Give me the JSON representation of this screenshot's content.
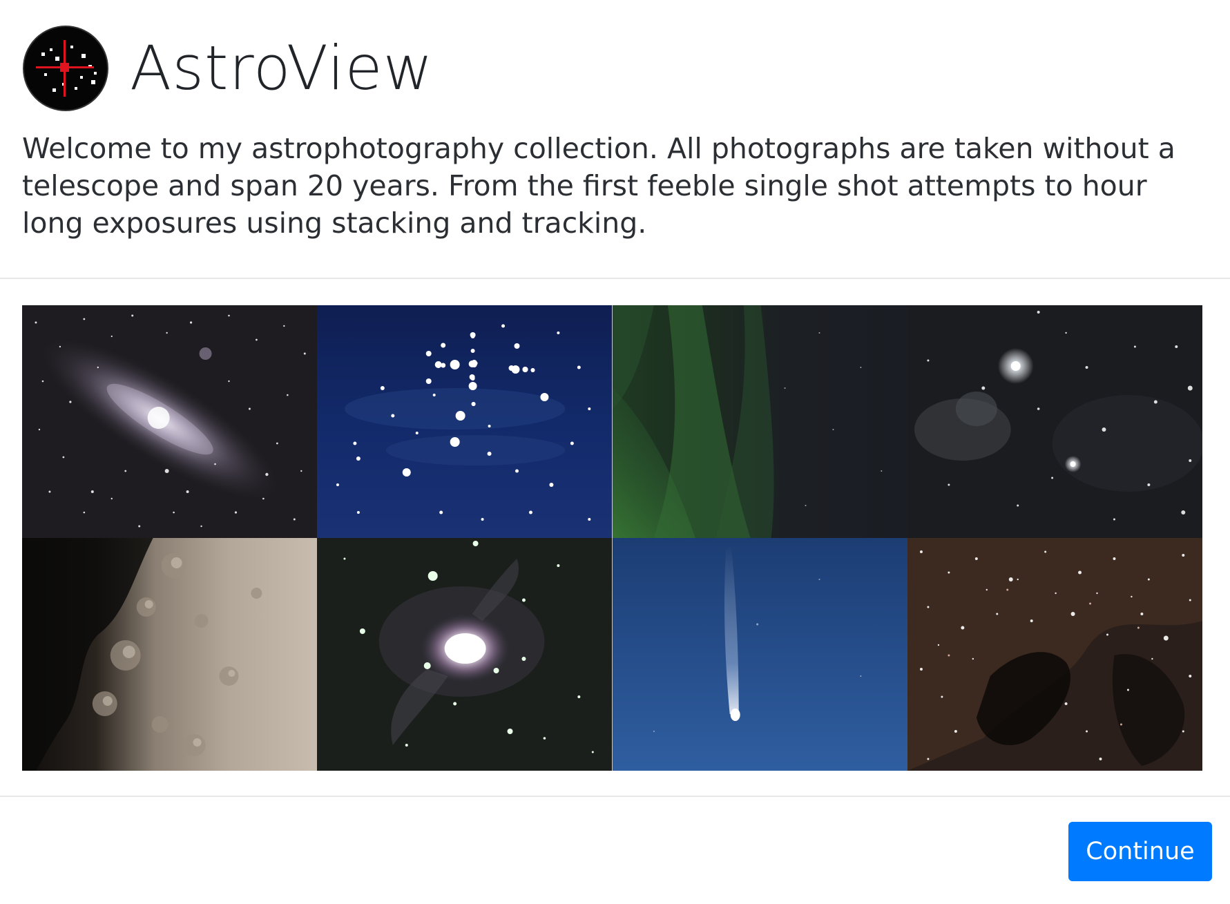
{
  "app": {
    "title": "AstroView",
    "logo_icon": "telescope-crosshair-icon"
  },
  "intro": {
    "text": "Welcome to my astrophotography collection. All photographs are taken without a telescope and span 20 years. From the first feeble single shot attempts to hour long exposures using stacking and tracking."
  },
  "gallery": {
    "photos": [
      {
        "subject": "andromeda-galaxy"
      },
      {
        "subject": "pleiades-cluster"
      },
      {
        "subject": "aurora"
      },
      {
        "subject": "horsehead-nebula"
      },
      {
        "subject": "moon-surface"
      },
      {
        "subject": "orion-nebula"
      },
      {
        "subject": "comet"
      },
      {
        "subject": "north-america-nebula"
      }
    ]
  },
  "footer": {
    "continue_label": "Continue"
  },
  "colors": {
    "accent": "#007bff",
    "divider": "#e7e7e7",
    "text": "#212529"
  }
}
